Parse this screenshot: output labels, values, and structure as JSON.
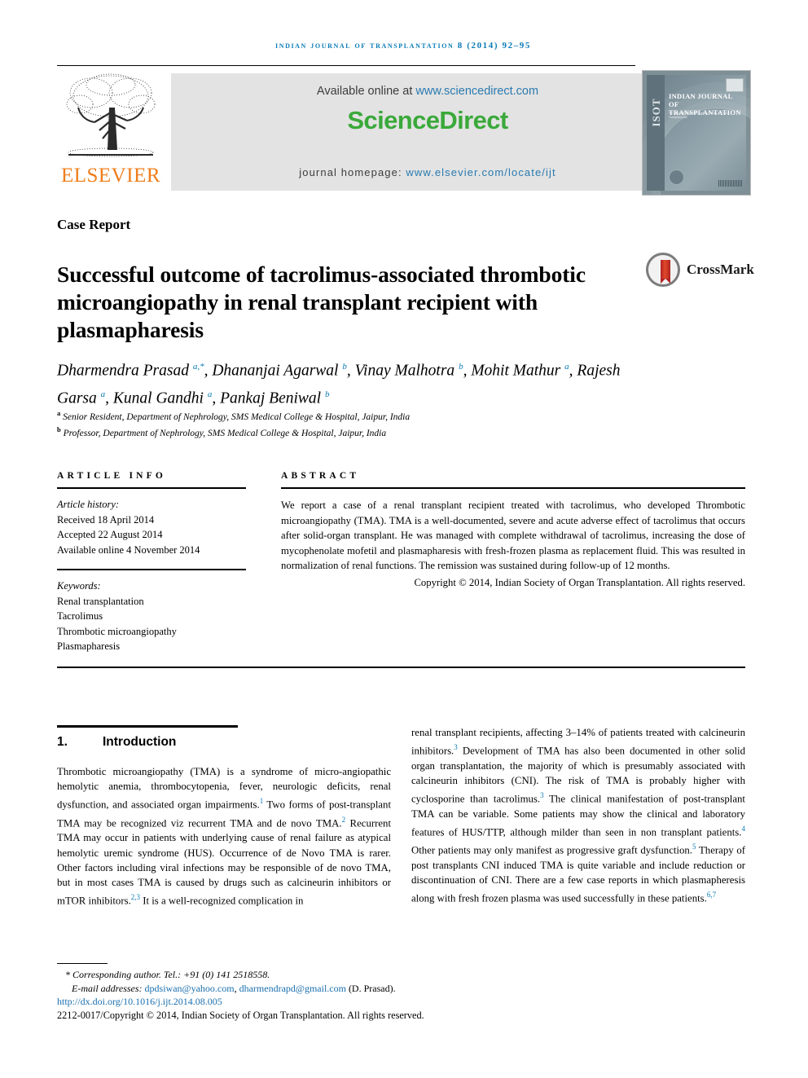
{
  "running_head": "Indian Journal of Transplantation 8 (2014) 92–95",
  "masthead": {
    "publisher_name": "ELSEVIER",
    "publisher_logo_alt": "elsevier-tree-logo",
    "available_prefix": "Available online at ",
    "available_link": "www.sciencedirect.com",
    "wordmark": "ScienceDirect",
    "homepage_prefix": "journal homepage: ",
    "homepage_link": "www.elsevier.com/locate/ijt",
    "cover": {
      "spine_text": "ISOT",
      "title": "INDIAN JOURNAL OF TRANSPLANTATION",
      "subtitle": "An Official Publication of Indian Society of Organ Transplantation"
    }
  },
  "article": {
    "type": "Case Report",
    "title": "Successful outcome of tacrolimus-associated thrombotic microangiopathy in renal transplant recipient with plasmapharesis",
    "crossmark_label": "CrossMark",
    "authors_html": "Dharmendra Prasad <sup>a,*</sup>, Dhananjai Agarwal <sup>b</sup>, Vinay Malhotra <sup>b</sup>, Mohit Mathur <sup>a</sup>, Rajesh Garsa <sup>a</sup>, Kunal Gandhi <sup>a</sup>, Pankaj Beniwal <sup>b</sup>",
    "affiliations_html": "<sup>a</sup> Senior Resident, Department of Nephrology, SMS Medical College &amp; Hospital, Jaipur, India<br><sup>b</sup> Professor, Department of Nephrology, SMS Medical College &amp; Hospital, Jaipur, India"
  },
  "info": {
    "heading": "ARTICLE INFO",
    "history_label": "Article history:",
    "received": "Received 18 April 2014",
    "accepted": "Accepted 22 August 2014",
    "available_online": "Available online 4 November 2014",
    "keywords_label": "Keywords:",
    "keywords": [
      "Renal transplantation",
      "Tacrolimus",
      "Thrombotic microangiopathy",
      "Plasmapharesis"
    ]
  },
  "abstract": {
    "heading": "ABSTRACT",
    "text": "We report a case of a renal transplant recipient treated with tacrolimus, who developed Thrombotic microangiopathy (TMA). TMA is a well-documented, severe and acute adverse effect of tacrolimus that occurs after solid-organ transplant. He was managed with complete withdrawal of tacrolimus, increasing the dose of mycophenolate mofetil and plasmapharesis with fresh-frozen plasma as replacement fluid. This was resulted in normalization of renal functions. The remission was sustained during follow-up of 12 months.",
    "copyright": "Copyright © 2014, Indian Society of Organ Transplantation. All rights reserved."
  },
  "sections": {
    "intro_number": "1.",
    "intro_title": "Introduction",
    "intro_left_html": "Thrombotic microangiopathy (TMA) is a syndrome of micro-angiopathic hemolytic anemia, thrombocytopenia, fever, neurologic deficits, renal dysfunction, and associated organ impairments.<sup>1</sup> Two forms of post-transplant TMA may be recognized viz recurrent TMA and de novo TMA.<sup>2</sup> Recurrent TMA may occur in patients with underlying cause of renal failure as atypical hemolytic uremic syndrome (HUS). Occurrence of de Novo TMA is rarer. Other factors including viral infections may be responsible of de novo TMA, but in most cases TMA is caused by drugs such as calcineurin inhibitors or mTOR inhibitors.<sup>2,3</sup> It is a well-recognized complication in",
    "intro_right_html": "renal transplant recipients, affecting 3–14% of patients treated with calcineurin inhibitors.<sup>3</sup> Development of TMA has also been documented in other solid organ transplantation, the majority of which is presumably associated with calcineurin inhibitors (CNI). The risk of TMA is probably higher with cyclosporine than tacrolimus.<sup>3</sup> The clinical manifestation of post-transplant TMA can be variable. Some patients may show the clinical and laboratory features of HUS/TTP, although milder than seen in non transplant patients.<sup>4</sup> Other patients may only manifest as progressive graft dysfunction.<sup>5</sup> Therapy of post transplants CNI induced TMA is quite variable and include reduction or discontinuation of CNI. There are a few case reports in which plasmapheresis along with fresh frozen plasma was used successfully in these patients.<sup>6,7</sup>"
  },
  "footer": {
    "corresponding": "* Corresponding author. Tel.: +91 (0) 141 2518558.",
    "email_label": "E-mail addresses: ",
    "email_1": "dpdsiwan@yahoo.com",
    "email_sep": ", ",
    "email_2": "dharmendrapd@gmail.com",
    "email_suffix": " (D. Prasad).",
    "doi": "http://dx.doi.org/10.1016/j.ijt.2014.08.005",
    "issn_copyright": "2212-0017/Copyright © 2014, Indian Society of Organ Transplantation. All rights reserved."
  },
  "colors": {
    "accent_blue": "#0b7bb5",
    "link_blue": "#2a7ab0",
    "sciencedirect_green": "#3aa93a",
    "elsevier_orange": "#ef7d1a",
    "band_gray": "#e3e3e3"
  }
}
